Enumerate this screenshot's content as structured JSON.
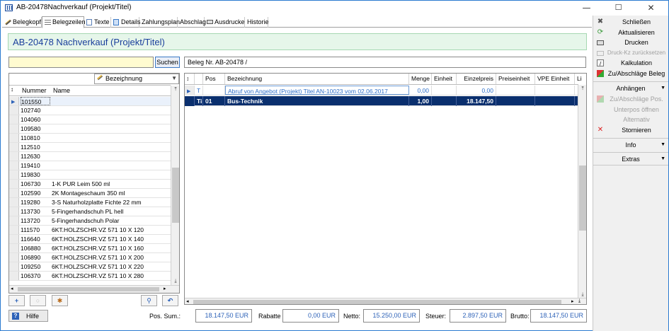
{
  "window": {
    "title": "AB-20478Nachverkauf (Projekt/Titel)",
    "minimize": "—",
    "maximize": "☐",
    "close": "✕"
  },
  "tabs": [
    {
      "label": "Belegkopf",
      "icon": "pencil-icon",
      "active": false
    },
    {
      "label": "Belegzeilen",
      "icon": "list-icon",
      "active": true
    },
    {
      "label": "Texte",
      "icon": "document-icon",
      "active": false
    },
    {
      "label": "Details",
      "icon": "details-icon",
      "active": false
    },
    {
      "label": "Zahlungsplan",
      "active": false
    },
    {
      "label": "Abschlag",
      "active": false
    },
    {
      "label": "Ausdrucke",
      "icon": "printer-icon",
      "active": false
    },
    {
      "label": "Historie",
      "active": false
    }
  ],
  "header": {
    "title": "AB-20478  Nachverkauf (Projekt/Titel)"
  },
  "search": {
    "value": "",
    "button_label": "Suchen"
  },
  "beleg_field": "Beleg Nr. AB-20478 /",
  "left_grid": {
    "sort_label": "Bezeichnung",
    "columns": [
      "Nummer",
      "Name"
    ],
    "rows": [
      {
        "num": "101550",
        "name": ""
      },
      {
        "num": "102740",
        "name": ""
      },
      {
        "num": "104060",
        "name": ""
      },
      {
        "num": "109580",
        "name": ""
      },
      {
        "num": "110810",
        "name": ""
      },
      {
        "num": "112510",
        "name": ""
      },
      {
        "num": "112630",
        "name": ""
      },
      {
        "num": "119410",
        "name": ""
      },
      {
        "num": "119830",
        "name": ""
      },
      {
        "num": "106730",
        "name": "1-K PUR Leim 500 ml"
      },
      {
        "num": "102590",
        "name": "2K Montageschaum 350 ml"
      },
      {
        "num": "119280",
        "name": "3-S Naturholzplatte Fichte 22 mm"
      },
      {
        "num": "113730",
        "name": "5-Fingerhandschuh PL hell"
      },
      {
        "num": "113720",
        "name": "5-Fingerhandschuh Polar"
      },
      {
        "num": "111570",
        "name": "6KT.HOLZSCHR.VZ  571   10 X 120"
      },
      {
        "num": "116640",
        "name": "6KT.HOLZSCHR.VZ  571   10 X 140"
      },
      {
        "num": "106880",
        "name": "6KT.HOLZSCHR.VZ  571   10 X 160"
      },
      {
        "num": "106890",
        "name": "6KT.HOLZSCHR.VZ  571   10 X 200"
      },
      {
        "num": "109250",
        "name": "6KT.HOLZSCHR.VZ  571   10 X 220"
      },
      {
        "num": "106370",
        "name": "6KT.HOLZSCHR.VZ  571   10 X 280"
      }
    ]
  },
  "pos_grid": {
    "columns": {
      "pos": "Pos",
      "bez": "Bezeichnung",
      "menge": "Menge",
      "einheit": "Einheit",
      "einzelpreis": "Einzelpreis",
      "preiseinheit": "Preiseinheit",
      "vpe": "VPE Einheit",
      "lie": "Lie"
    },
    "rows": [
      {
        "marker": "T",
        "pos": "",
        "bez": "Abruf von Angebot (Projekt) Titel AN-10023 vom 02.06.2017",
        "menge": "0,00",
        "einheit": "",
        "einzelpreis": "0,00",
        "preiseinheit": "",
        "vpe": ""
      },
      {
        "marker": "Ti",
        "pos": "01",
        "bez": "Bus-Technik",
        "menge": "1,00",
        "einheit": "",
        "einzelpreis": "18.147,50",
        "preiseinheit": "",
        "vpe": ""
      }
    ]
  },
  "totals": {
    "help_label": "Hilfe",
    "pos_sum_label": "Pos. Sum.:",
    "pos_sum": "18.147,50  EUR",
    "rabatte_label": "Rabatte",
    "rabatte": "0,00  EUR",
    "netto_label": "Netto:",
    "netto": "15.250,00  EUR",
    "steuer_label": "Steuer:",
    "steuer": "2.897,50  EUR",
    "brutto_label": "Brutto:",
    "brutto": "18.147,50  EUR"
  },
  "actions": {
    "items": [
      {
        "label": "Schließen",
        "icon": "close-icon",
        "enabled": true
      },
      {
        "label": "Aktualisieren",
        "icon": "refresh-icon",
        "enabled": true
      },
      {
        "label": "Drucken",
        "icon": "printer-icon",
        "enabled": true
      },
      {
        "label": "Druck-Kz zurücksetzen",
        "icon": "printer-reset-icon",
        "enabled": false
      },
      {
        "label": "Kalkulation",
        "icon": "calculator-icon",
        "enabled": true
      },
      {
        "label": "Zu/Abschläge Beleg",
        "icon": "discount-icon",
        "enabled": true
      }
    ],
    "anhaengen_label": "Anhängen",
    "sub_items": [
      {
        "label": "Zu/Abschläge Pos.",
        "icon": "discount-icon",
        "enabled": false
      },
      {
        "label": "Unterpos öffnen",
        "enabled": false
      },
      {
        "label": "Alternativ",
        "enabled": false
      },
      {
        "label": "Stornieren",
        "icon": "cancel-icon",
        "enabled": true
      }
    ],
    "info_label": "Info",
    "extras_label": "Extras"
  },
  "colors": {
    "accent": "#0a2f6e",
    "header_bg": "#e6f6ea",
    "title_blue": "#1a3f9c",
    "link_blue": "#2f70c9"
  }
}
